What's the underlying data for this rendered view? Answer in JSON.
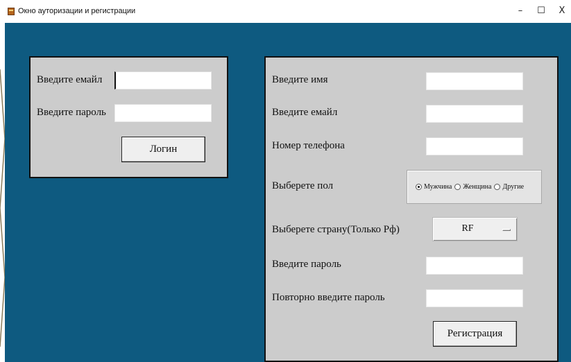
{
  "window": {
    "title": "Окно аутоpизации и регистрации",
    "minimize_glyph": "–",
    "maximize_glyph": "☐",
    "close_glyph": "X"
  },
  "colors": {
    "client_bg": "#0e5a80",
    "panel_bg": "#cccccc"
  },
  "login": {
    "email_label": "Введите емайл",
    "email_value": "",
    "password_label": "Введите пароль",
    "password_value": "",
    "login_button": "Логин"
  },
  "register": {
    "name_label": "Введите имя",
    "name_value": "",
    "email_label": "Введите емайл",
    "email_value": "",
    "phone_label": "Номер телефона",
    "phone_value": "",
    "gender_label": "Выберете пол",
    "gender_options": [
      {
        "label": "Мужчина",
        "selected": true
      },
      {
        "label": "Женщина",
        "selected": false
      },
      {
        "label": "Другие",
        "selected": false
      }
    ],
    "country_label": "Выберете страну(Только Рф)",
    "country_value": "RF",
    "password_label": "Введите пароль",
    "password_value": "",
    "repeat_password_label": "Повторно введите пароль",
    "repeat_password_value": "",
    "register_button": "Регистрация"
  }
}
